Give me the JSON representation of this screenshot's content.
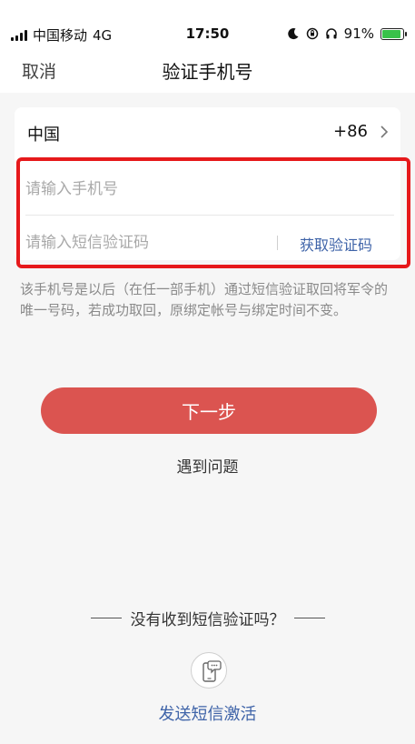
{
  "status_bar": {
    "carrier": "中国移动",
    "network": "4G",
    "time": "17:50",
    "battery_text": "91%",
    "battery_level": 0.91
  },
  "nav": {
    "cancel_label": "取消",
    "title": "验证手机号"
  },
  "form": {
    "country_name": "中国",
    "country_code": "+86",
    "phone_placeholder": "请输入手机号",
    "code_placeholder": "请输入短信验证码",
    "get_code_label": "获取验证码"
  },
  "hint": "该手机号是以后（在任一部手机）通过短信验证取回将军令的唯一号码，若成功取回，原绑定帐号与绑定时间不变。",
  "next_label": "下一步",
  "problem_label": "遇到问题",
  "no_sms_text": "没有收到短信验证吗？",
  "send_sms_label": "发送短信激活",
  "colors": {
    "accent_red": "#db5450",
    "highlight_red": "#e6191b",
    "link_blue": "#3e63a8",
    "battery_green": "#39c24a"
  }
}
